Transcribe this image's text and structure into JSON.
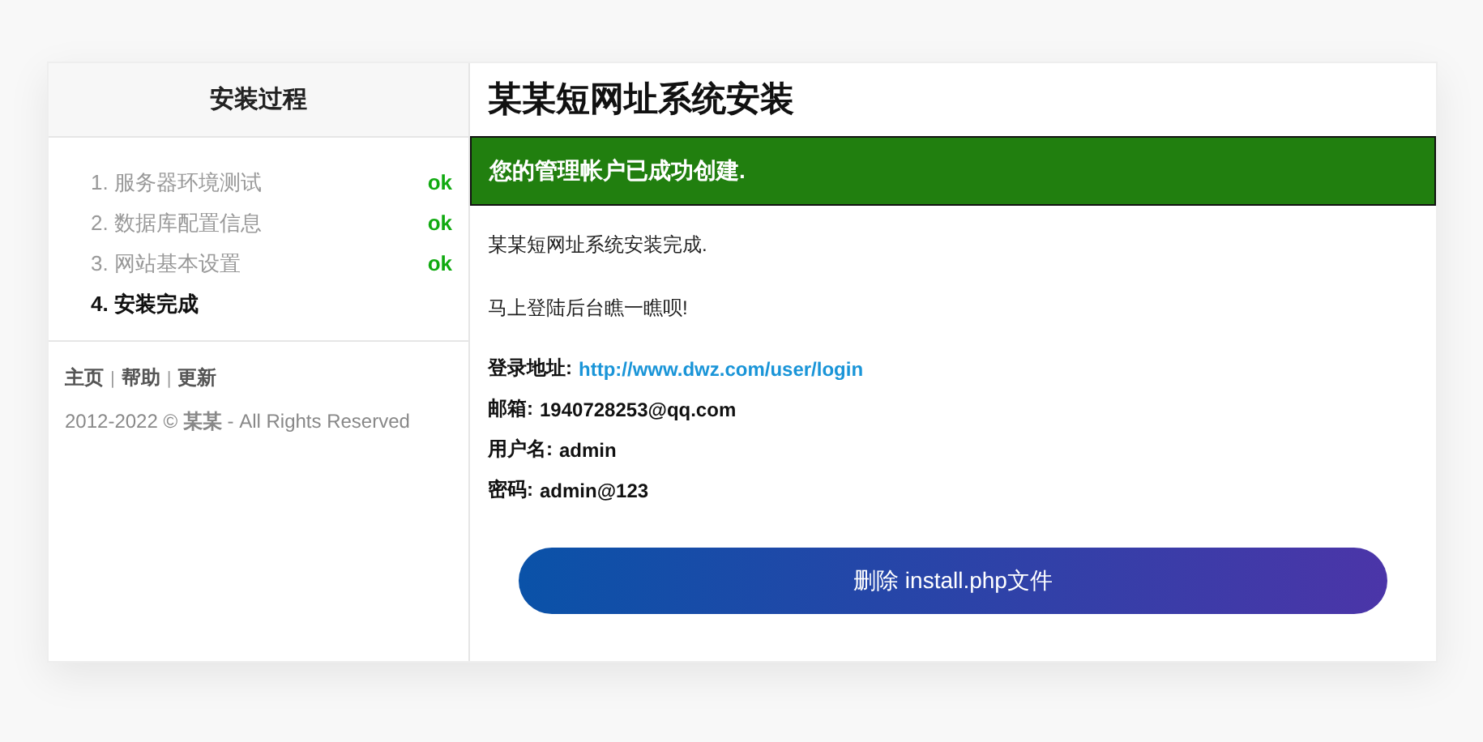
{
  "sidebar": {
    "title": "安装过程",
    "steps": [
      {
        "label": "1. 服务器环境测试",
        "done": true,
        "status": "ok"
      },
      {
        "label": "2. 数据库配置信息",
        "done": true,
        "status": "ok"
      },
      {
        "label": "3. 网站基本设置",
        "done": true,
        "status": "ok"
      },
      {
        "label": "4. 安装完成",
        "done": false
      }
    ],
    "footer_links": [
      "主页",
      "帮助",
      "更新"
    ],
    "separator": "|",
    "copyright": "2012-2022 © **某某** - All Rights Reserved"
  },
  "main": {
    "title": "某某短网址系统安装",
    "banner": "您的管理帐户已成功创建.",
    "paragraphs": [
      "某某短网址系统安装完成.",
      "马上登陆后台瞧一瞧呗!"
    ],
    "details": [
      {
        "label": "登录地址:",
        "value": "http://www.dwz.com/user/login",
        "kind": "link"
      },
      {
        "label": "邮箱:",
        "value": "1940728253@qq.com",
        "kind": "text"
      },
      {
        "label": "用户名:",
        "value": "admin",
        "kind": "text"
      },
      {
        "label": "密码:",
        "value": "admin@123",
        "kind": "text"
      }
    ],
    "button": "删除 install.php文件"
  }
}
